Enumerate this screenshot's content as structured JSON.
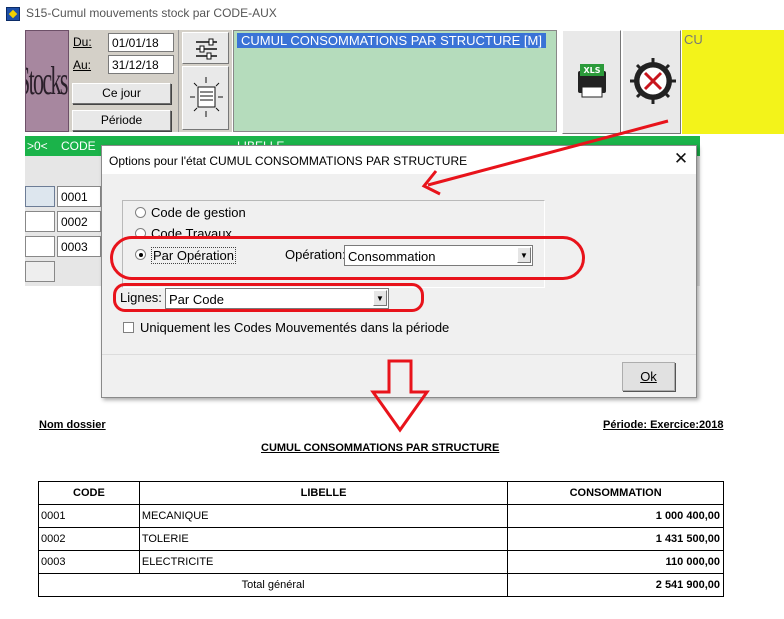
{
  "window": {
    "title": "S15-Cumul mouvements stock par CODE-AUX"
  },
  "toolbar": {
    "logo_text": "Stocks",
    "du_label": "Du:",
    "du_value": "01/01/18",
    "au_label": "Au:",
    "au_value": "31/12/18",
    "ce_jour_label": "Ce jour",
    "periode_label": "Période",
    "report_title": "CUMUL CONSOMMATIONS PAR STRUCTURE   [M]",
    "xls_label": "XLS",
    "right_label": "CU"
  },
  "grid": {
    "headers": [
      ">0<",
      "CODE",
      "LIBELLE"
    ],
    "codes": [
      "0001",
      "0002",
      "0003"
    ]
  },
  "dialog": {
    "title": "Options pour l'état CUMUL CONSOMMATIONS PAR STRUCTURE",
    "close": "✕",
    "radio_options": [
      {
        "label": "Code de gestion",
        "checked": false
      },
      {
        "label": "Code Travaux",
        "checked": false
      },
      {
        "label": "Par Opération",
        "checked": true
      }
    ],
    "operation_label": "Opération:",
    "operation_value": "Consommation",
    "lignes_label": "Lignes:",
    "lignes_value": "Par Code",
    "checkbox_label": "Uniquement les Codes Mouvementés dans la période",
    "checkbox_checked": false,
    "ok_label": "Ok"
  },
  "report": {
    "nom_dossier": "Nom dossier",
    "periode": "Période: Exercice:2018",
    "title": "CUMUL CONSOMMATIONS PAR STRUCTURE",
    "columns": [
      "CODE",
      "LIBELLE",
      "CONSOMMATION"
    ],
    "rows": [
      {
        "code": "0001",
        "libelle": "MECANIQUE",
        "consommation": "1 000 400,00"
      },
      {
        "code": "0002",
        "libelle": "TOLERIE",
        "consommation": "1 431 500,00"
      },
      {
        "code": "0003",
        "libelle": "ELECTRICITE",
        "consommation": "110 000,00"
      }
    ],
    "total_label": "Total général",
    "total_value": "2 541 900,00"
  },
  "colors": {
    "annotation_red": "#e8131b",
    "grid_green": "#1bb34a",
    "title_box_green": "#b5dcbc"
  }
}
